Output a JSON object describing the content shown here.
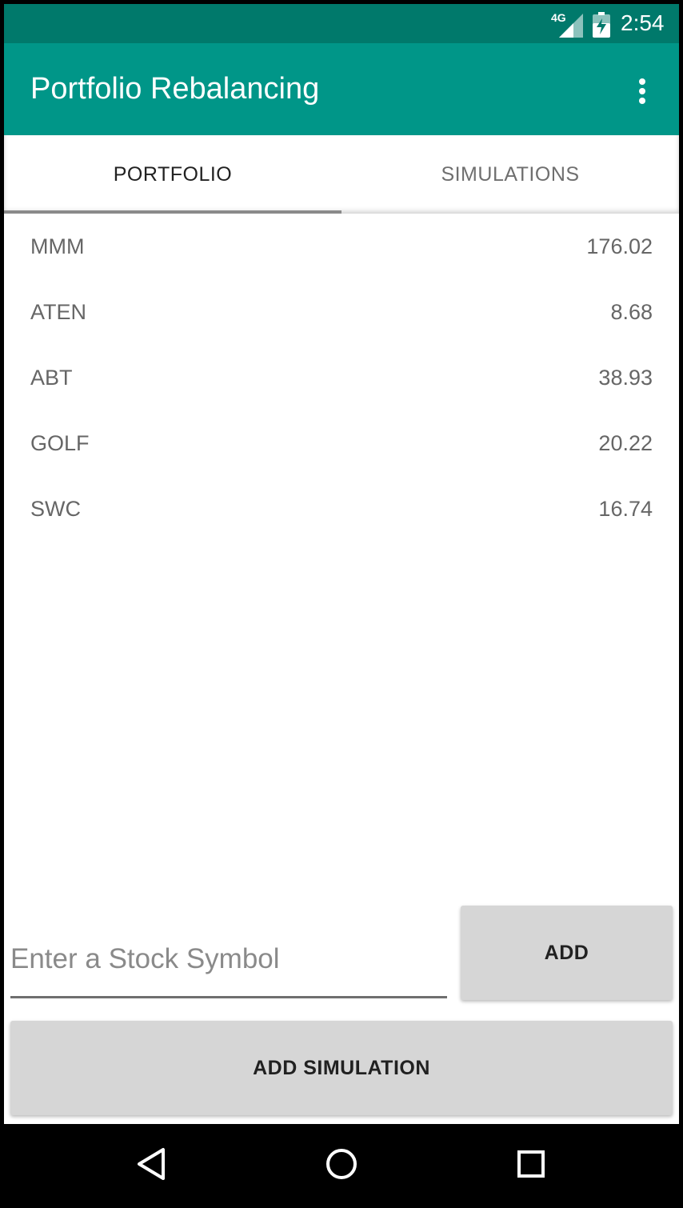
{
  "status_bar": {
    "network": "4G",
    "time": "2:54",
    "icons": [
      "signal-icon",
      "battery-charging-icon"
    ]
  },
  "app_bar": {
    "title": "Portfolio Rebalancing",
    "menu_icon": "overflow-menu-icon"
  },
  "tabs": [
    {
      "label": "PORTFOLIO",
      "selected": true
    },
    {
      "label": "SIMULATIONS",
      "selected": false
    }
  ],
  "portfolio": [
    {
      "symbol": "MMM",
      "value": "176.02"
    },
    {
      "symbol": "ATEN",
      "value": "8.68"
    },
    {
      "symbol": "ABT",
      "value": "38.93"
    },
    {
      "symbol": "GOLF",
      "value": "20.22"
    },
    {
      "symbol": "SWC",
      "value": "16.74"
    }
  ],
  "input": {
    "value": "",
    "placeholder": "Enter a Stock Symbol"
  },
  "buttons": {
    "add": "ADD",
    "add_simulation": "ADD SIMULATION"
  },
  "nav": {
    "back_icon": "back-icon",
    "home_icon": "home-icon",
    "recents_icon": "recents-icon"
  },
  "colors": {
    "primary": "#009688",
    "primary_dark": "#00796b",
    "button_bg": "#d6d6d6"
  }
}
